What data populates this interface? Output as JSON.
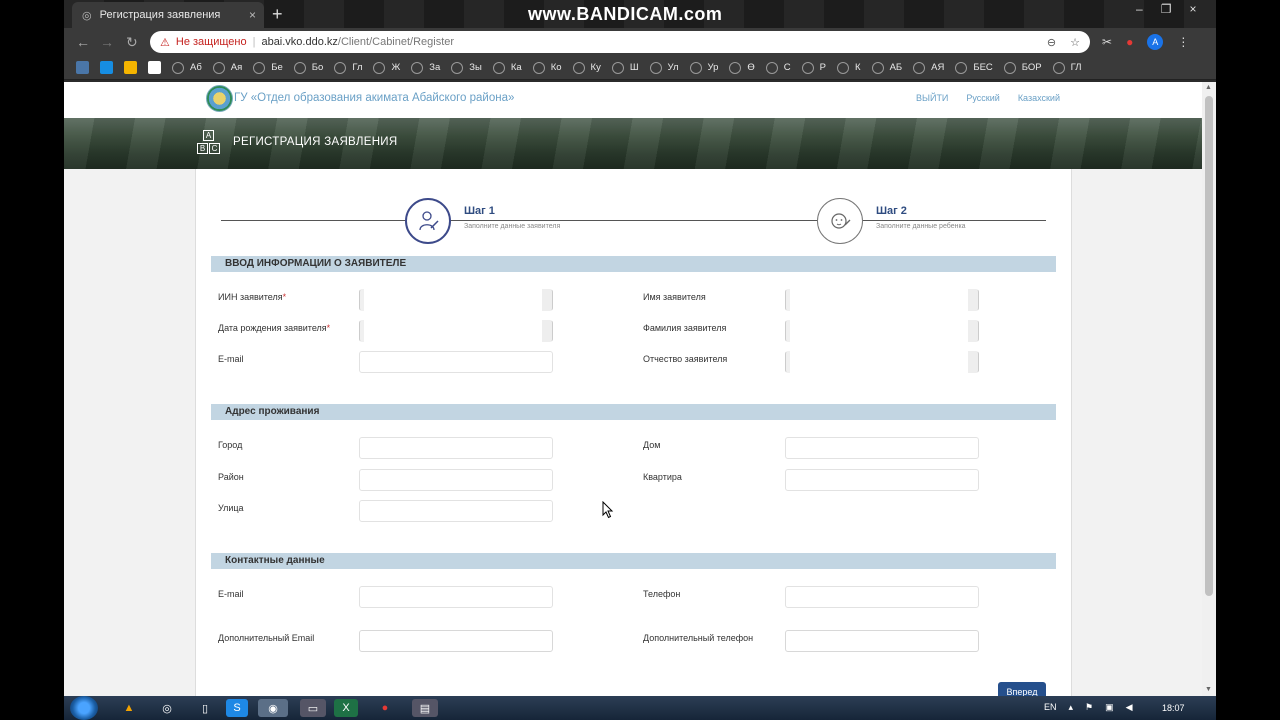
{
  "browser": {
    "tab_title": "Регистрация заявления",
    "tab_close": "×",
    "new_tab": "+",
    "watermark": "www.BANDICAM.com",
    "window_controls": [
      "–",
      "❐",
      "×"
    ],
    "security_warning": "Не защищено",
    "url_domain": "abai.vko.ddo.kz",
    "url_path": "/Client/Cabinet/Register",
    "profile_initial": "A",
    "bookmarks": [
      "Аб",
      "Ая",
      "Бе",
      "Бо",
      "Гл",
      "Ж",
      "За",
      "Зы",
      "Ка",
      "Ко",
      "Ку",
      "Ш",
      "Ул",
      "Ур",
      "Ө",
      "С",
      "Р",
      "К",
      "АБ",
      "АЯ",
      "БЕС",
      "БОР",
      "ГЛ"
    ]
  },
  "header": {
    "org_name": "ГУ «Отдел образования акимата Абайского района»",
    "logout": "ВЫЙТИ",
    "lang_ru": "Русский",
    "lang_kz": "Казахский"
  },
  "banner": {
    "title": "РЕГИСТРАЦИЯ ЗАЯВЛЕНИЯ",
    "abc": [
      "A",
      "B",
      "C"
    ]
  },
  "steps": [
    {
      "title": "Шаг 1",
      "subtitle": "Заполните данные заявителя"
    },
    {
      "title": "Шаг 2",
      "subtitle": "Заполните данные ребенка"
    }
  ],
  "sections": {
    "applicant": "ВВОД ИНФОРМАЦИИ О ЗАЯВИТЕЛЕ",
    "address": "Адрес проживания",
    "contacts": "Контактные данные"
  },
  "fields": {
    "iin": "ИИН заявителя",
    "birthdate": "Дата рождения заявителя",
    "email1": "E-mail",
    "first_name": "Имя заявителя",
    "last_name": "Фамилия заявителя",
    "patronymic": "Отчество заявителя",
    "city": "Город",
    "district": "Район",
    "street": "Улица",
    "house": "Дом",
    "apartment": "Квартира",
    "email2": "E-mail",
    "phone": "Телефон",
    "extra_email": "Дополнительный Email",
    "extra_phone": "Дополнительный телефон",
    "required_mark": "*"
  },
  "buttons": {
    "next": "Вперед"
  },
  "taskbar": {
    "lang": "EN",
    "time": "18:07"
  }
}
